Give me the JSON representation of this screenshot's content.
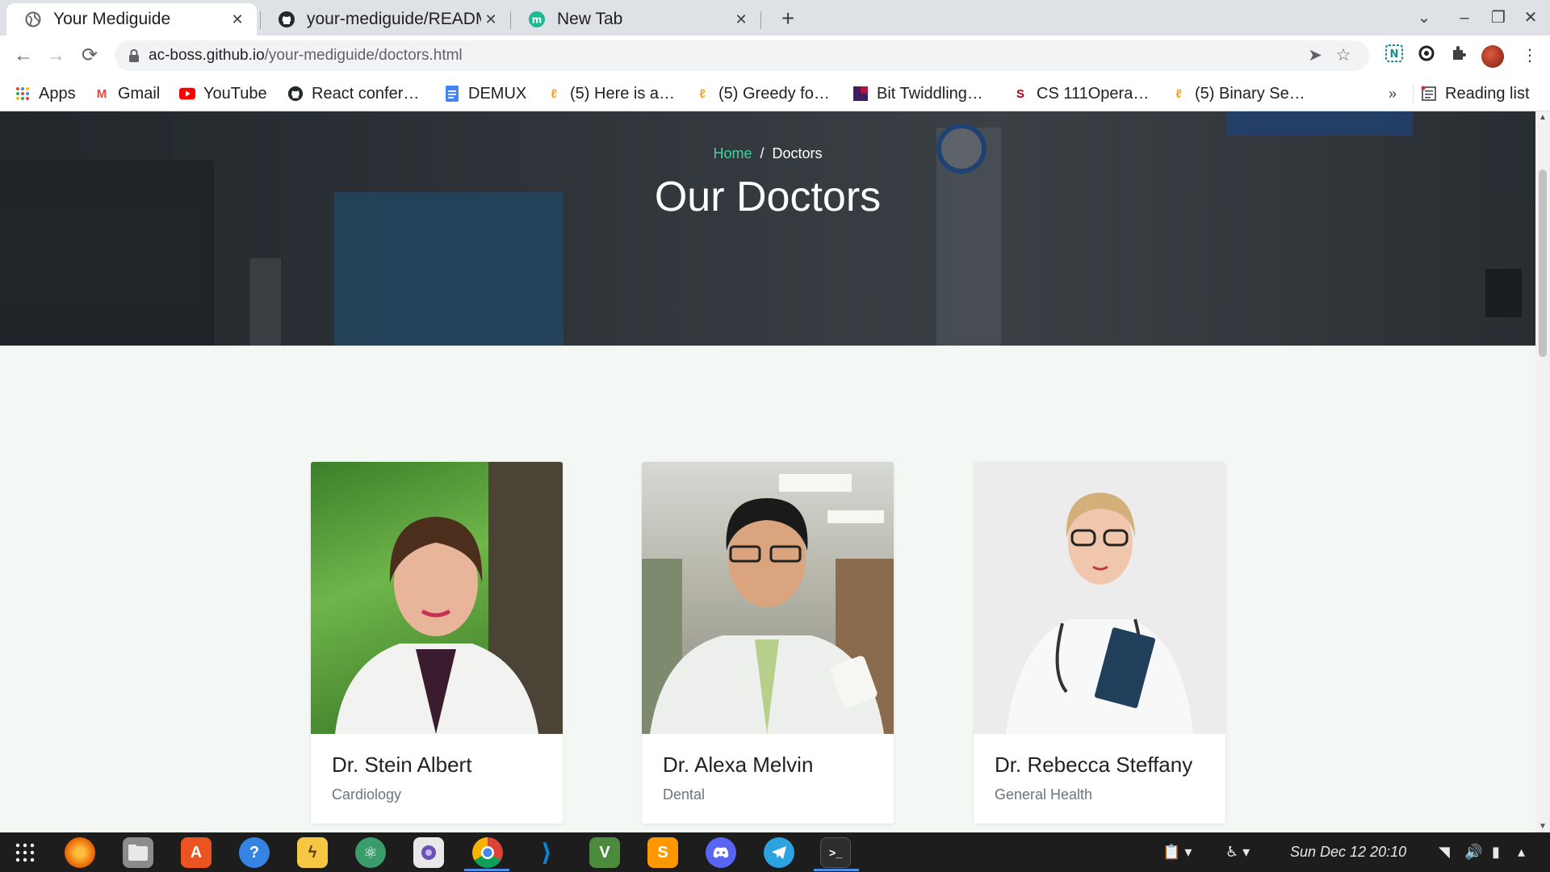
{
  "browser": {
    "tabs": [
      {
        "title": "Your Mediguide",
        "active": true,
        "icon": "globe-icon"
      },
      {
        "title": "your-mediguide/READM",
        "active": false,
        "icon": "github-icon"
      },
      {
        "title": "New Tab",
        "active": false,
        "icon": "m-icon"
      }
    ],
    "new_tab_label": "+",
    "url_host": "ac-boss.github.io",
    "url_path": "/your-mediguide/doctors.html",
    "bookmarks": [
      {
        "label": "Apps",
        "icon": "apps-grid-icon"
      },
      {
        "label": "Gmail",
        "icon": "gmail-icon"
      },
      {
        "label": "YouTube",
        "icon": "youtube-icon"
      },
      {
        "label": "React confer…",
        "icon": "github-icon"
      },
      {
        "label": "DEMUX",
        "icon": "docs-icon"
      },
      {
        "label": "(5) Here is a…",
        "icon": "leetcode-icon"
      },
      {
        "label": "(5) Greedy fo…",
        "icon": "leetcode-icon"
      },
      {
        "label": "Bit Twiddling…",
        "icon": "bookmark-icon"
      },
      {
        "label": "CS 111Opera…",
        "icon": "stanford-icon"
      },
      {
        "label": "(5) Binary Se…",
        "icon": "leetcode-icon"
      }
    ],
    "more_bookmarks": "»",
    "reading_list": "Reading list"
  },
  "page": {
    "breadcrumb_home": "Home",
    "breadcrumb_sep": "/",
    "breadcrumb_current": "Doctors",
    "title": "Our Doctors",
    "doctors": [
      {
        "name": "Dr. Stein Albert",
        "specialty": "Cardiology"
      },
      {
        "name": "Dr. Alexa Melvin",
        "specialty": "Dental"
      },
      {
        "name": "Dr. Rebecca Steffany",
        "specialty": "General Health"
      }
    ]
  },
  "taskbar": {
    "apps": [
      {
        "name": "app-grid",
        "color": "#1d1d1d"
      },
      {
        "name": "firefox",
        "color": "#e66000"
      },
      {
        "name": "files",
        "color": "#8c8c8c"
      },
      {
        "name": "software",
        "color": "#e95420"
      },
      {
        "name": "help",
        "color": "#3584e4"
      },
      {
        "name": "pikachu",
        "color": "#f6c744"
      },
      {
        "name": "atom",
        "color": "#3a9c6b"
      },
      {
        "name": "screenshot",
        "color": "#e8e8e8"
      },
      {
        "name": "chrome",
        "color": "#db4437"
      },
      {
        "name": "vscode",
        "color": "#0078d4"
      },
      {
        "name": "vim",
        "color": "#4c8a3e"
      },
      {
        "name": "sublime",
        "color": "#ff9800"
      },
      {
        "name": "discord",
        "color": "#5865f2"
      },
      {
        "name": "telegram",
        "color": "#2aa3df"
      },
      {
        "name": "terminal",
        "color": "#2e2e2e"
      }
    ],
    "clock": "Sun Dec 12  20:10"
  },
  "colors": {
    "accent": "#3fd3a0",
    "page_bg": "#f3f8f5"
  }
}
